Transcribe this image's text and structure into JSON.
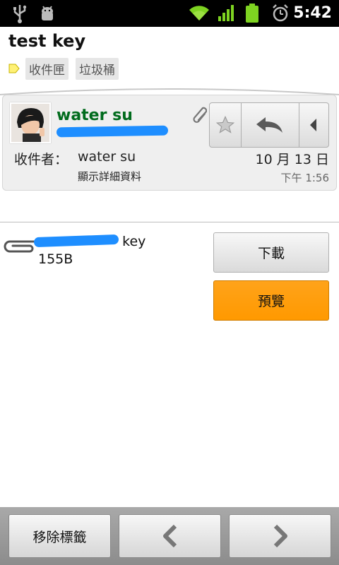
{
  "status_bar": {
    "time": "5:42",
    "icons": [
      "usb-icon",
      "android-debug-icon",
      "wifi-icon",
      "signal-icon",
      "battery-icon",
      "alarm-icon"
    ],
    "battery_color": "#7ed321"
  },
  "message": {
    "subject": "test key",
    "labels": [
      "收件匣",
      "垃圾桶"
    ],
    "sender_name": "water su",
    "to_label": "收件者：",
    "to_name": "water su",
    "show_details": "顯示詳細資料",
    "date": "10 月 13 日",
    "time": "下午 1:56"
  },
  "attachment": {
    "name": "key",
    "size": "155B",
    "download_label": "下載",
    "preview_label": "預覽"
  },
  "bottom_bar": {
    "remove_label": "移除標籤"
  },
  "colors": {
    "sender": "#006b1c",
    "preview_button": "#ff9900",
    "redaction": "#1e8eff"
  }
}
